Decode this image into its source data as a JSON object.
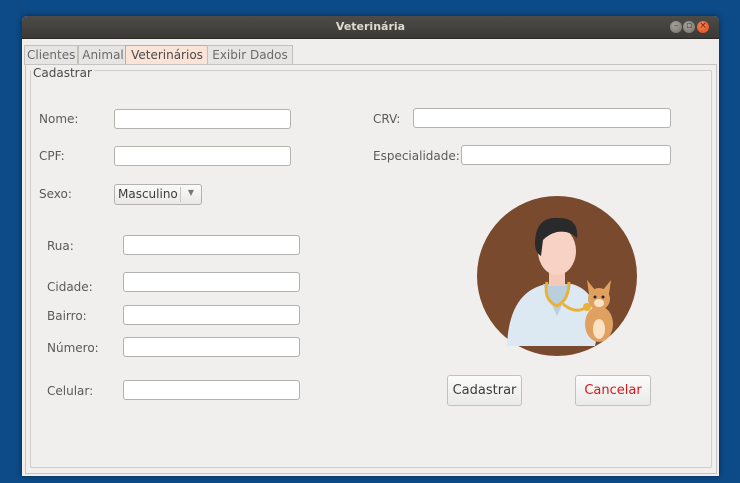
{
  "window": {
    "title": "Veterinária"
  },
  "tabs": [
    {
      "label": "Clientes"
    },
    {
      "label": "Animal"
    },
    {
      "label": "Veterinários"
    },
    {
      "label": "Exibir Dados"
    }
  ],
  "active_tab": "Veterinários",
  "group": {
    "title": "Cadastrar"
  },
  "form": {
    "nome": {
      "label": "Nome:",
      "value": ""
    },
    "cpf": {
      "label": "CPF:",
      "value": ""
    },
    "sexo": {
      "label": "Sexo:",
      "value": "Masculino"
    },
    "crv": {
      "label": "CRV:",
      "value": ""
    },
    "especialidade": {
      "label": "Especialidade:",
      "value": ""
    },
    "rua": {
      "label": "Rua:",
      "value": ""
    },
    "cidade": {
      "label": "Cidade:",
      "value": ""
    },
    "bairro": {
      "label": "Bairro:",
      "value": ""
    },
    "numero": {
      "label": "Número:",
      "value": ""
    },
    "celular": {
      "label": "Celular:",
      "value": ""
    }
  },
  "buttons": {
    "cadastrar": "Cadastrar",
    "cancelar": "Cancelar"
  },
  "colors": {
    "desktop": "#0c4a88",
    "cancel_text": "#d8161f",
    "avatar_bg": "#7a4a2e"
  },
  "image": {
    "icon": "veterinarian-with-dog-icon"
  }
}
